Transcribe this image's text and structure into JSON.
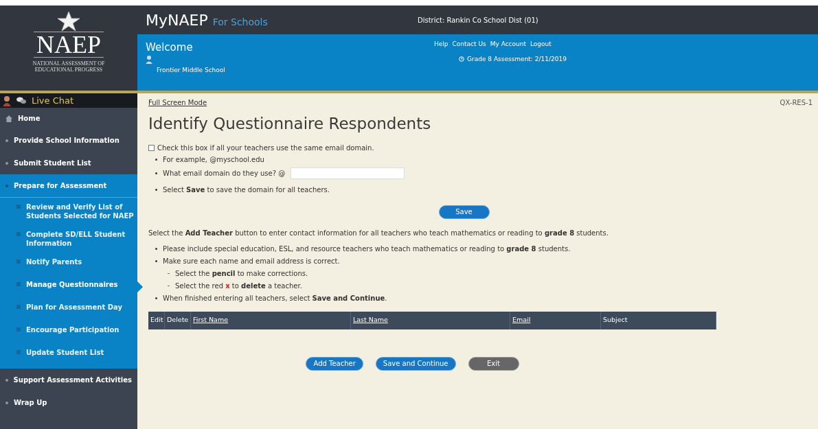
{
  "logo": {
    "wordmark": "NAEP",
    "tagline": "NATIONAL ASSESSMENT OF EDUCATIONAL PROGRESS"
  },
  "header": {
    "title": "MyNAEP",
    "subtitle": "For Schools",
    "district": "District: Rankin Co School Dist (01)",
    "welcome": "Welcome",
    "school": "Frontier Middle School",
    "links": [
      "Help",
      "Contact Us",
      "My Account",
      "Logout"
    ],
    "assessment": "Grade 8 Assessment: 2/11/2019"
  },
  "live_chat": "Live Chat",
  "sidebar": {
    "items": [
      {
        "label": "Home",
        "kind": "home",
        "selected": false
      },
      {
        "label": "Provide School Information",
        "kind": "section",
        "selected": false
      },
      {
        "label": "Submit Student List",
        "kind": "section",
        "selected": false
      },
      {
        "label": "Prepare for Assessment",
        "kind": "section",
        "selected": false,
        "expanded": true,
        "children": [
          {
            "label": "Review and Verify List of Students Selected for NAEP",
            "selected": false
          },
          {
            "label": "Complete SD/ELL Student Information",
            "selected": false
          },
          {
            "label": "Notify Parents",
            "selected": false
          },
          {
            "label": "Manage Questionnaires",
            "selected": true
          },
          {
            "label": "Plan for Assessment Day",
            "selected": false
          },
          {
            "label": "Encourage Participation",
            "selected": false
          },
          {
            "label": "Update Student List",
            "selected": false
          }
        ]
      },
      {
        "label": "Support Assessment Activities",
        "kind": "section",
        "selected": false
      },
      {
        "label": "Wrap Up",
        "kind": "section",
        "selected": false
      }
    ]
  },
  "full_screen_link": "Full Screen Mode",
  "page_code": "QX-RES-1",
  "page_title": "Identify Questionnaire Respondents",
  "same_domain": {
    "label": "Check this box if all your teachers use the same email domain.",
    "checked": false,
    "example": "For example, @myschool.edu",
    "question": "What email domain do they use? @",
    "save_hint": "Select **Save** to save the domain for all teachers.",
    "save_button": "Save"
  },
  "instructions": {
    "intro": "Select the **Add Teacher** button to enter contact information for all teachers who teach mathematics or reading to **grade 8** students.",
    "bullets": [
      {
        "text": "Please include special education, ESL, and resource teachers who teach mathematics or reading to **grade 8** students."
      },
      {
        "text": "Make sure each name and email address is correct.",
        "children": [
          {
            "text": "Select the **pencil** to make corrections.",
            "kind": "plain"
          },
          {
            "text": "Select the red **x** to **delete** a teacher.",
            "kind": "delete"
          }
        ]
      },
      {
        "text": "When finished entering all teachers, select **Save and Continue**."
      }
    ]
  },
  "table": {
    "columns": [
      {
        "label": "Edit",
        "sortable": false
      },
      {
        "label": "Delete",
        "sortable": false
      },
      {
        "label": "First Name",
        "sortable": true
      },
      {
        "label": "Last Name",
        "sortable": true
      },
      {
        "label": "Email",
        "sortable": true
      },
      {
        "label": "Subject",
        "sortable": false
      }
    ]
  },
  "buttons": [
    {
      "label": "Add Teacher",
      "kind": "primary"
    },
    {
      "label": "Save and Continue",
      "kind": "primary"
    },
    {
      "label": "Exit",
      "kind": "secondary"
    }
  ]
}
